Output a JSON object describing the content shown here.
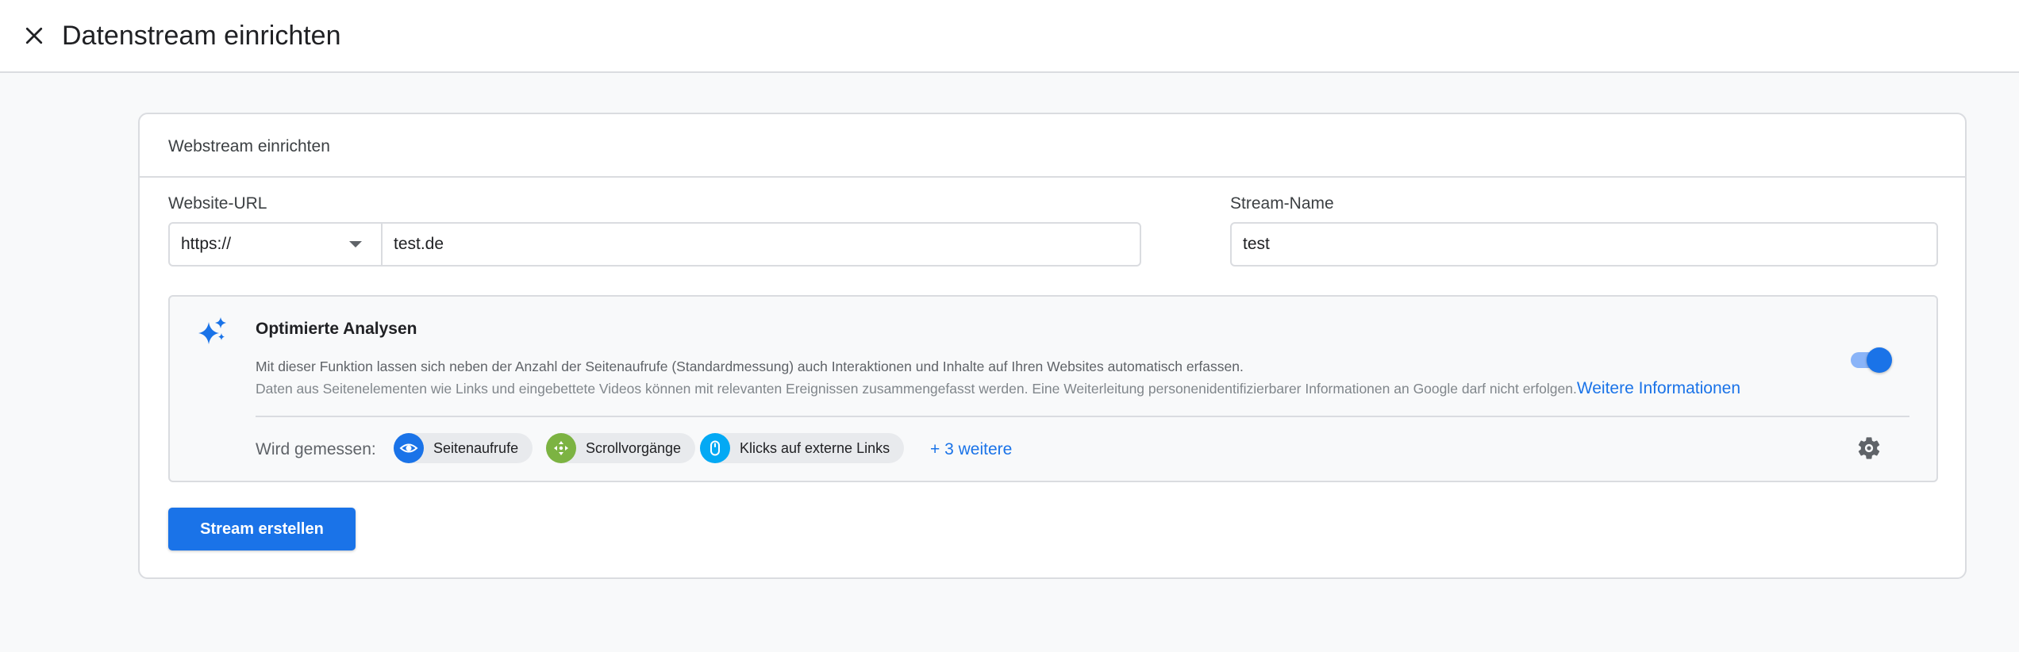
{
  "header": {
    "title": "Datenstream einrichten",
    "close_icon": "close-icon"
  },
  "card": {
    "title": "Webstream einrichten",
    "website_url": {
      "label": "Website-URL",
      "protocol": "https://",
      "value": "test.de"
    },
    "stream_name": {
      "label": "Stream-Name",
      "value": "test"
    },
    "enhanced": {
      "icon": "sparkle-icon",
      "title": "Optimierte Analysen",
      "description_1": "Mit dieser Funktion lassen sich neben der Anzahl der Seitenaufrufe (Standardmessung) auch Interaktionen und Inhalte auf Ihren Websites automatisch erfassen.",
      "description_2": "Daten aus Seitenelementen wie Links und eingebettete Videos können mit relevanten Ereignissen zusammengefasst werden. Eine Weiterleitung personenidentifizierbarer Informationen an Google darf nicht erfolgen.",
      "more_info_link": "Weitere Informationen",
      "toggle_on": true,
      "measured_label": "Wird gemessen:",
      "chips": [
        {
          "label": "Seitenaufrufe",
          "icon": "eye-icon",
          "color": "#1a73e8"
        },
        {
          "label": "Scrollvorgänge",
          "icon": "scroll-icon",
          "color": "#7cb342"
        },
        {
          "label": "Klicks auf externe Links",
          "icon": "mouse-icon",
          "color": "#03a9f4"
        }
      ],
      "more_chips": "+ 3 weitere",
      "settings_icon": "gear-icon"
    },
    "create_button": "Stream erstellen"
  },
  "colors": {
    "primary": "#1a73e8",
    "border": "#dadce0",
    "background": "#f8f9fa"
  }
}
